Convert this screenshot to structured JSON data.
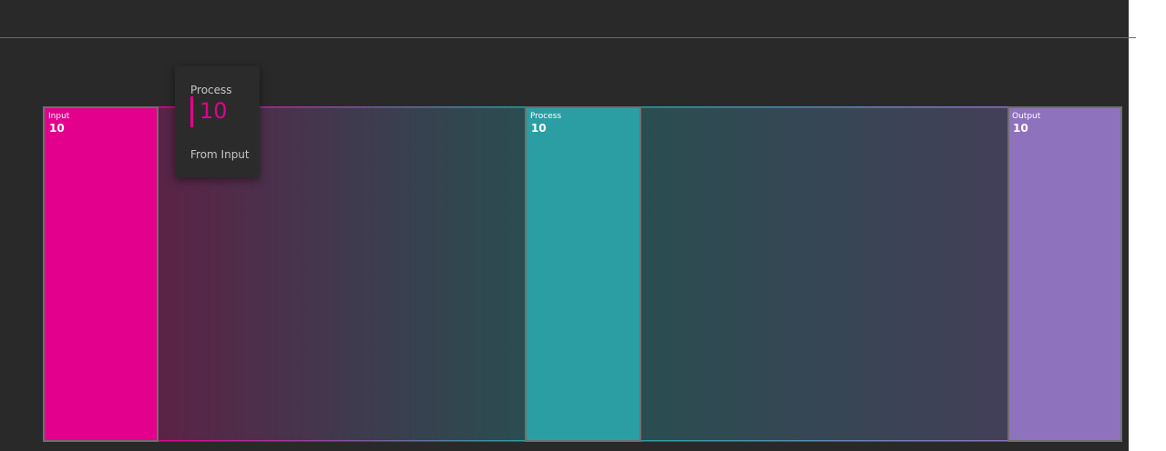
{
  "colors": {
    "background": "#292929",
    "input": "#e3008c",
    "process": "#2b9ea3",
    "output": "#8f72bd",
    "link_from_input": "#5b2346",
    "link_mid": "#41394e",
    "link_to_process": "#2a4d50",
    "link_to_output": "#433f58",
    "node_border": "#6f6f6f"
  },
  "chart_data": {
    "type": "sankey",
    "nodes": [
      {
        "name": "Input",
        "value": 10
      },
      {
        "name": "Process",
        "value": 10
      },
      {
        "name": "Output",
        "value": 10
      }
    ],
    "links": [
      {
        "source": "Input",
        "target": "Process",
        "value": 10
      },
      {
        "source": "Process",
        "target": "Output",
        "value": 10
      }
    ]
  },
  "tooltip": {
    "title": "Process",
    "value": "10",
    "subtitle": "From Input"
  }
}
